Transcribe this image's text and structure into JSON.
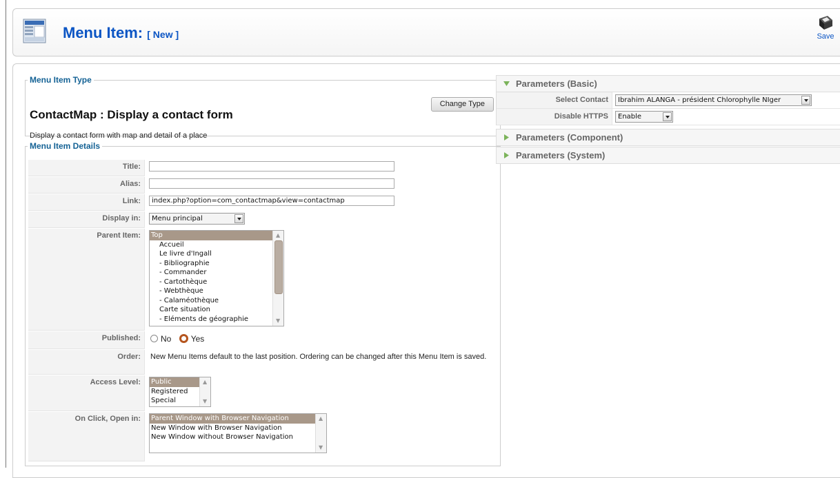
{
  "header": {
    "title": "Menu Item:",
    "subtitle": "[ New ]",
    "save_label": "Save",
    "accent": "#0b55c4"
  },
  "type_panel": {
    "legend": "Menu Item Type",
    "type_name": "ContactMap : Display a contact form",
    "description": "Display a contact form with map and detail of a place",
    "change_button": "Change Type"
  },
  "details": {
    "legend": "Menu Item Details",
    "title": {
      "label": "Title:",
      "value": ""
    },
    "alias": {
      "label": "Alias:",
      "value": ""
    },
    "link": {
      "label": "Link:",
      "value": "index.php?option=com_contactmap&view=contactmap"
    },
    "display_in": {
      "label": "Display in:",
      "value": "Menu principal"
    },
    "parent_item": {
      "label": "Parent Item:",
      "options": [
        "Top",
        "Accueil",
        "Le livre d'Ingall",
        "- Bibliographie",
        "- Commander",
        "- Cartothèque",
        "- Webthèque",
        "- Calaméothèque",
        "Carte situation",
        "- Eléments de géographie"
      ],
      "selected": 0
    },
    "published": {
      "label": "Published:",
      "no": "No",
      "yes": "Yes",
      "value": "Yes"
    },
    "order": {
      "label": "Order:",
      "text": "New Menu Items default to the last position. Ordering can be changed after this Menu Item is saved."
    },
    "access_level": {
      "label": "Access Level:",
      "options": [
        "Public",
        "Registered",
        "Special"
      ],
      "selected": 0
    },
    "on_click": {
      "label": "On Click, Open in:",
      "options": [
        "Parent Window with Browser Navigation",
        "New Window with Browser Navigation",
        "New Window without Browser Navigation"
      ],
      "selected": 0
    },
    "selection_color": "#a89889"
  },
  "params": {
    "basic": {
      "label": "Parameters (Basic)",
      "expanded": true,
      "select_contact": {
        "label": "Select Contact",
        "value": "Ibrahim ALANGA - président Chlorophylle NIger"
      },
      "disable_https": {
        "label": "Disable HTTPS",
        "value": "Enable"
      }
    },
    "component": {
      "label": "Parameters (Component)",
      "expanded": false
    },
    "system": {
      "label": "Parameters (System)",
      "expanded": false
    }
  }
}
